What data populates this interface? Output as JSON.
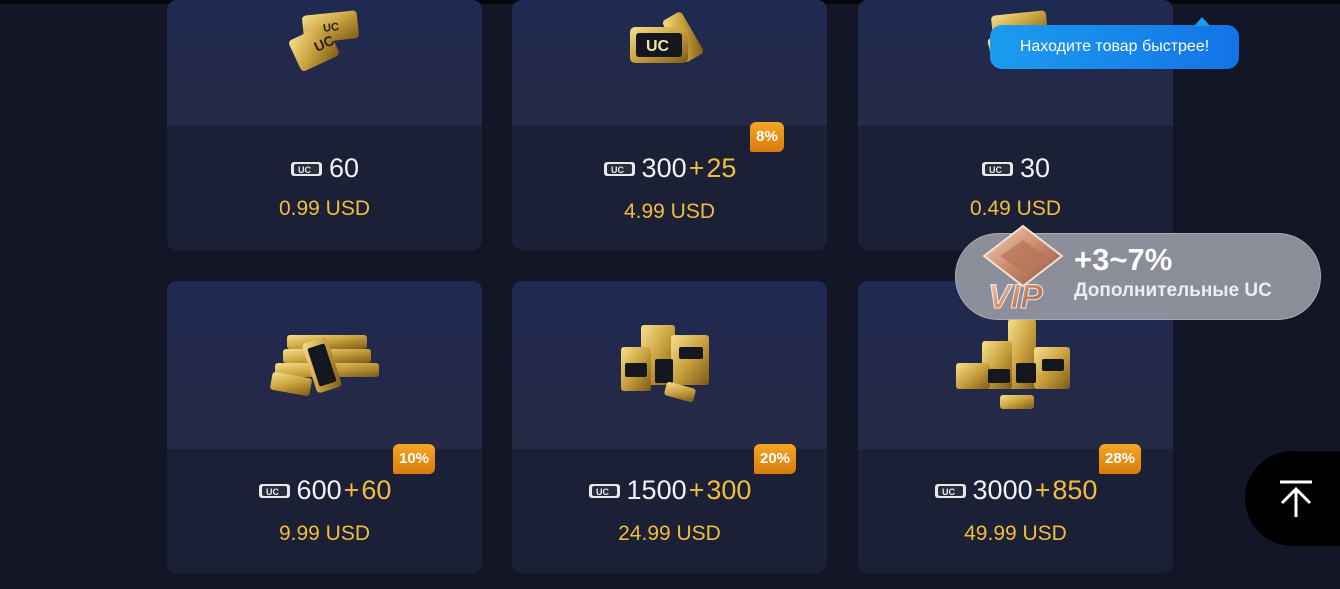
{
  "tooltip": {
    "text": "Находите товар быстрее!"
  },
  "vip": {
    "label": "VIP",
    "percent": "+3~7%",
    "subtitle": "Дополнительные UC"
  },
  "products": [
    {
      "base": "60",
      "plus": "",
      "bonus": "",
      "price": "0.99 USD",
      "badge": ""
    },
    {
      "base": "300",
      "plus": "+",
      "bonus": "25",
      "price": "4.99 USD",
      "badge": "8%"
    },
    {
      "base": "30",
      "plus": "",
      "bonus": "",
      "price": "0.49 USD",
      "badge": ""
    },
    {
      "base": "600",
      "plus": "+",
      "bonus": "60",
      "price": "9.99 USD",
      "badge": "10%"
    },
    {
      "base": "1500",
      "plus": "+",
      "bonus": "300",
      "price": "24.99 USD",
      "badge": "20%"
    },
    {
      "base": "3000",
      "plus": "+",
      "bonus": "850",
      "price": "49.99 USD",
      "badge": "28%"
    }
  ],
  "icons": {
    "currency": "uc-coin-icon",
    "scroll_top": "arrow-up-to-top-icon"
  },
  "colors": {
    "accent_gold": "#f0bd3c",
    "badge_orange": "#f5a623",
    "tooltip_blue": "#1d9bf0"
  }
}
